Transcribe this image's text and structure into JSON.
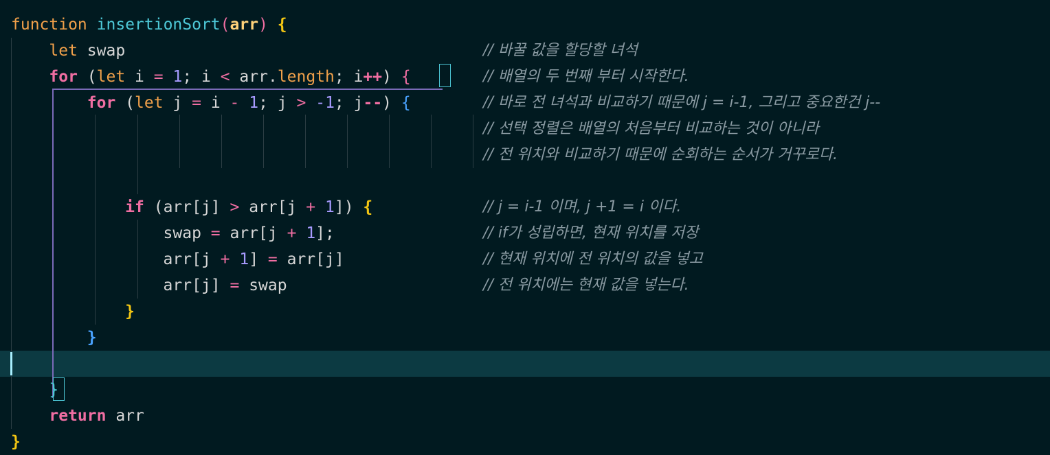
{
  "colors": {
    "background": "#011a20",
    "active_line": "#0c3a42",
    "keyword": "#f06ea2",
    "keyword_soft": "#f0a04a",
    "function_name": "#4ec9d8",
    "param": "#ffd37a",
    "identifier": "#d7d7d7",
    "number": "#a89bff",
    "brace": "#f3c613",
    "brace_inner": "#4aa3ff",
    "comment": "#8a9aa2"
  },
  "code_lines": [
    {
      "tokens": [
        {
          "text": "function",
          "c": "#f0a04a"
        },
        {
          "text": " "
        },
        {
          "text": "insertionSort",
          "c": "#4ec9d8"
        },
        {
          "text": "(",
          "c": "#f06ea2"
        },
        {
          "text": "arr",
          "c": "#ffd37a",
          "b": true
        },
        {
          "text": ")",
          "c": "#f06ea2"
        },
        {
          "text": " "
        },
        {
          "text": "{",
          "c": "#f3c613",
          "b": true
        }
      ]
    },
    {
      "tokens": [
        {
          "text": "    "
        },
        {
          "text": "let",
          "c": "#f0a04a"
        },
        {
          "text": " swap"
        }
      ],
      "comment": "// 바꿀 값을 할당할 녀석"
    },
    {
      "tokens": [
        {
          "text": "    "
        },
        {
          "text": "for",
          "c": "#f06ea2",
          "b": true
        },
        {
          "text": " ("
        },
        {
          "text": "let",
          "c": "#f0a04a"
        },
        {
          "text": " i "
        },
        {
          "text": "=",
          "c": "#f06ea2"
        },
        {
          "text": " "
        },
        {
          "text": "1",
          "c": "#a89bff"
        },
        {
          "text": "; i "
        },
        {
          "text": "<",
          "c": "#f06ea2"
        },
        {
          "text": " arr."
        },
        {
          "text": "length",
          "c": "#f0a04a"
        },
        {
          "text": "; i"
        },
        {
          "text": "++",
          "c": "#f06ea2",
          "b": true
        },
        {
          "text": ") "
        },
        {
          "text": "{",
          "c": "#f06ea2"
        }
      ],
      "comment": "// 배열의 두 번째 부터 시작한다."
    },
    {
      "tokens": [
        {
          "text": "        "
        },
        {
          "text": "for",
          "c": "#f06ea2",
          "b": true
        },
        {
          "text": " ("
        },
        {
          "text": "let",
          "c": "#f0a04a"
        },
        {
          "text": " j "
        },
        {
          "text": "=",
          "c": "#f06ea2"
        },
        {
          "text": " i "
        },
        {
          "text": "-",
          "c": "#f06ea2"
        },
        {
          "text": " "
        },
        {
          "text": "1",
          "c": "#a89bff"
        },
        {
          "text": "; j "
        },
        {
          "text": ">",
          "c": "#f06ea2"
        },
        {
          "text": " "
        },
        {
          "text": "-1",
          "c": "#a89bff"
        },
        {
          "text": "; j"
        },
        {
          "text": "--",
          "c": "#f06ea2",
          "b": true
        },
        {
          "text": ") "
        },
        {
          "text": "{",
          "c": "#4aa3ff"
        }
      ],
      "comment": "// 바로 전 녀석과 비교하기 때문에 j = i-1, 그리고 중요한건 j--"
    },
    {
      "tokens": [],
      "comment": "// 선택 정렬은 배열의 처음부터 비교하는 것이 아니라"
    },
    {
      "tokens": [],
      "comment": "// 전 위치와 비교하기 때문에 순회하는 순서가 거꾸로다."
    },
    {
      "tokens": []
    },
    {
      "tokens": [
        {
          "text": "            "
        },
        {
          "text": "if",
          "c": "#f06ea2",
          "b": true
        },
        {
          "text": " (arr[j] "
        },
        {
          "text": ">",
          "c": "#f06ea2"
        },
        {
          "text": " arr[j "
        },
        {
          "text": "+",
          "c": "#f06ea2"
        },
        {
          "text": " "
        },
        {
          "text": "1",
          "c": "#a89bff"
        },
        {
          "text": "]) "
        },
        {
          "text": "{",
          "c": "#f3c613",
          "b": true
        }
      ],
      "comment": "// j = i-1 이며, j +1 = i 이다."
    },
    {
      "tokens": [
        {
          "text": "                swap "
        },
        {
          "text": "=",
          "c": "#f06ea2"
        },
        {
          "text": " arr[j "
        },
        {
          "text": "+",
          "c": "#f06ea2"
        },
        {
          "text": " "
        },
        {
          "text": "1",
          "c": "#a89bff"
        },
        {
          "text": "];"
        }
      ],
      "comment": "// if가 성립하면, 현재 위치를 저장"
    },
    {
      "tokens": [
        {
          "text": "                arr[j "
        },
        {
          "text": "+",
          "c": "#f06ea2"
        },
        {
          "text": " "
        },
        {
          "text": "1",
          "c": "#a89bff"
        },
        {
          "text": "] "
        },
        {
          "text": "=",
          "c": "#f06ea2"
        },
        {
          "text": " arr[j]"
        }
      ],
      "comment": "// 현재 위치에 전 위치의 값을 넣고"
    },
    {
      "tokens": [
        {
          "text": "                arr[j] "
        },
        {
          "text": "=",
          "c": "#f06ea2"
        },
        {
          "text": " swap"
        }
      ],
      "comment": "// 전 위치에는 현재 값을 넣는다."
    },
    {
      "tokens": [
        {
          "text": "            "
        },
        {
          "text": "}",
          "c": "#f3c613",
          "b": true
        }
      ]
    },
    {
      "tokens": [
        {
          "text": "        "
        },
        {
          "text": "}",
          "c": "#4aa3ff",
          "b": true
        }
      ]
    },
    {
      "tokens": []
    },
    {
      "tokens": [
        {
          "text": "    "
        },
        {
          "text": "}",
          "c": "#4ec9d8"
        }
      ]
    },
    {
      "tokens": [
        {
          "text": "    "
        },
        {
          "text": "return",
          "c": "#f06ea2",
          "b": true
        },
        {
          "text": " arr"
        }
      ]
    },
    {
      "tokens": [
        {
          "text": "}",
          "c": "#f3c613",
          "b": true
        }
      ]
    }
  ]
}
